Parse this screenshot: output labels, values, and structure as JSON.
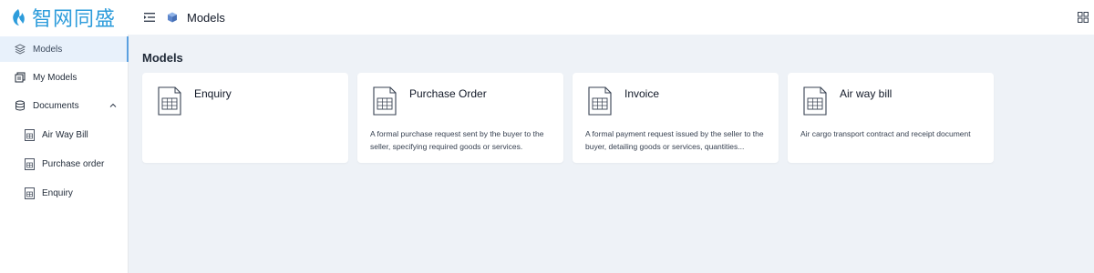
{
  "brand": {
    "name": "智网同盛",
    "logo_icon": "flame-logo-icon"
  },
  "header": {
    "breadcrumb": "Models",
    "menu_icon": "menu-fold-icon",
    "apps_icon": "grid-apps-icon"
  },
  "sidebar": {
    "items": [
      {
        "label": "Models",
        "icon": "layers-icon",
        "active": true
      },
      {
        "label": "My Models",
        "icon": "stack-icon",
        "active": false
      },
      {
        "label": "Documents",
        "icon": "database-icon",
        "expanded": true
      }
    ],
    "documents": [
      {
        "label": "Air Way Bill",
        "icon": "document-icon"
      },
      {
        "label": "Purchase order",
        "icon": "document-icon"
      },
      {
        "label": "Enquiry",
        "icon": "document-icon"
      }
    ]
  },
  "main": {
    "title": "Models",
    "cards": [
      {
        "title": "Enquiry",
        "description": ""
      },
      {
        "title": "Purchase Order",
        "description": "A formal purchase request sent by the buyer to the seller, specifying required goods or services."
      },
      {
        "title": "Invoice",
        "description": "A formal payment request issued by the seller to the buyer, detailing goods or services, quantities..."
      },
      {
        "title": "Air way bill",
        "description": "Air cargo transport contract and receipt document"
      }
    ]
  },
  "colors": {
    "accent": "#2d9cdb",
    "active_bg": "#e8f1fb",
    "page_bg": "#eef2f7"
  }
}
